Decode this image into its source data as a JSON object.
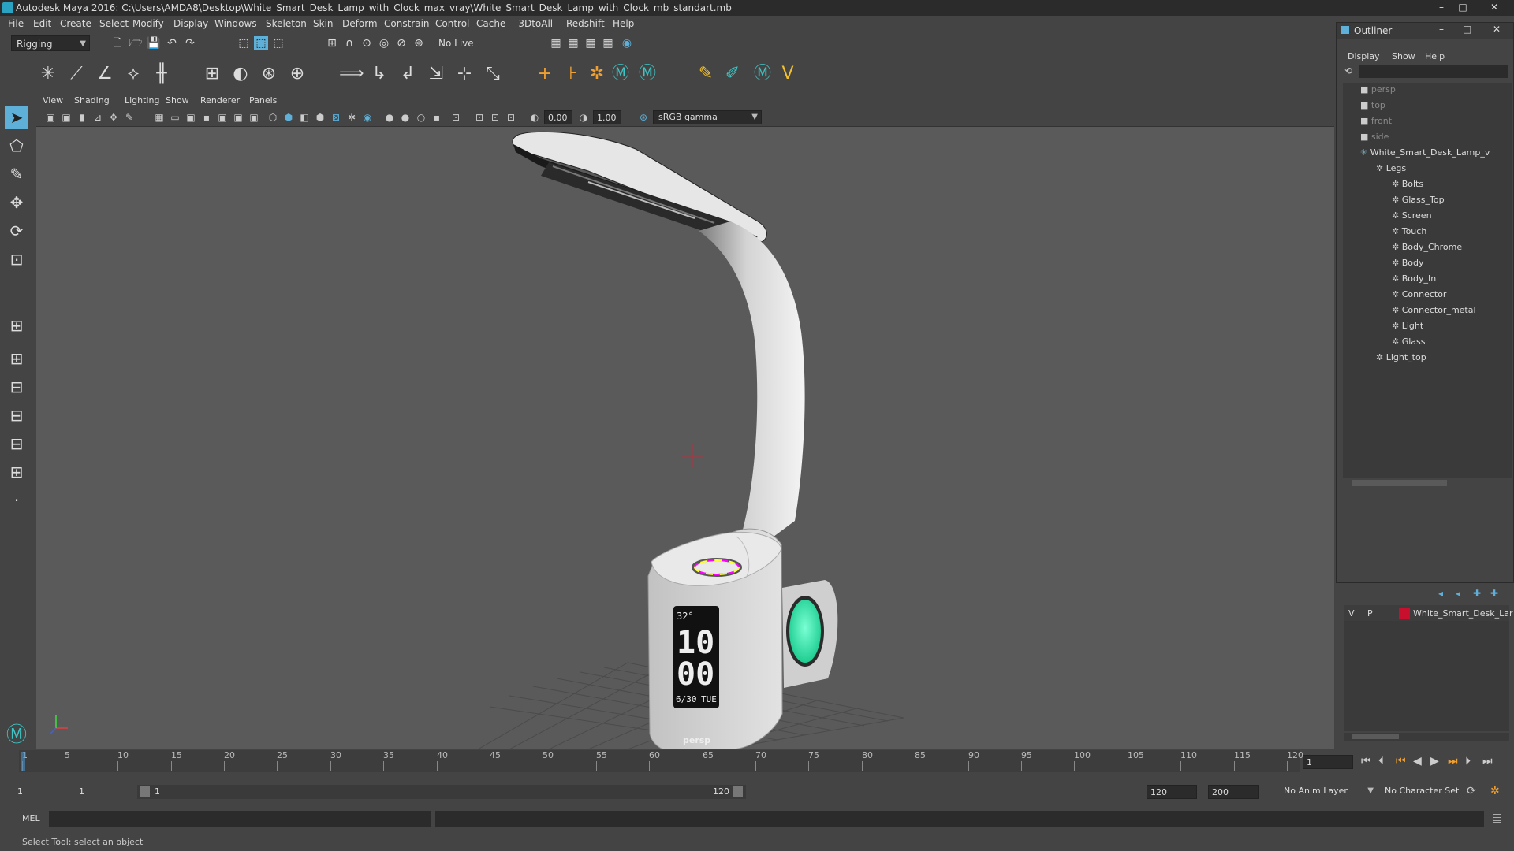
{
  "window": {
    "title": "Autodesk Maya 2016: C:\\Users\\AMDA8\\Desktop\\White_Smart_Desk_Lamp_with_Clock_max_vray\\White_Smart_Desk_Lamp_with_Clock_mb_standart.mb",
    "min": "–",
    "max": "□",
    "close": "✕"
  },
  "menu": [
    "File",
    "Edit",
    "Create",
    "Select",
    "Modify",
    "Display",
    "Windows",
    "Skeleton",
    "Skin",
    "Deform",
    "Constrain",
    "Control",
    "Cache",
    "-3DtoAll -",
    "Redshift",
    "Help"
  ],
  "status": {
    "mode": "Rigging",
    "live_surface": "No Live Surface"
  },
  "panel_menu": [
    "View",
    "Shading",
    "Lighting",
    "Show",
    "Renderer",
    "Panels"
  ],
  "panel_toolbar": {
    "exposure": "0.00",
    "gamma": "1.00",
    "colorspace": "sRGB gamma"
  },
  "viewport": {
    "camera_label": "persp",
    "clock": {
      "temp": "32°",
      "hour": "10",
      "minute": "00",
      "date": "6/30",
      "day": "TUE"
    }
  },
  "outliner": {
    "title": "Outliner",
    "menu": [
      "Display",
      "Show",
      "Help"
    ],
    "items": [
      {
        "label": "persp",
        "dim": true,
        "level": 0,
        "kind": "camera"
      },
      {
        "label": "top",
        "dim": true,
        "level": 0,
        "kind": "camera"
      },
      {
        "label": "front",
        "dim": true,
        "level": 0,
        "kind": "camera"
      },
      {
        "label": "side",
        "dim": true,
        "level": 0,
        "kind": "camera"
      },
      {
        "label": "White_Smart_Desk_Lamp_v",
        "dim": false,
        "level": 0,
        "kind": "group"
      },
      {
        "label": "Legs",
        "dim": false,
        "level": 1,
        "kind": "mesh"
      },
      {
        "label": "Bolts",
        "dim": false,
        "level": 2,
        "kind": "mesh"
      },
      {
        "label": "Glass_Top",
        "dim": false,
        "level": 2,
        "kind": "mesh"
      },
      {
        "label": "Screen",
        "dim": false,
        "level": 2,
        "kind": "mesh"
      },
      {
        "label": "Touch",
        "dim": false,
        "level": 2,
        "kind": "mesh"
      },
      {
        "label": "Body_Chrome",
        "dim": false,
        "level": 2,
        "kind": "mesh"
      },
      {
        "label": "Body",
        "dim": false,
        "level": 2,
        "kind": "mesh"
      },
      {
        "label": "Body_In",
        "dim": false,
        "level": 2,
        "kind": "mesh"
      },
      {
        "label": "Connector",
        "dim": false,
        "level": 2,
        "kind": "mesh"
      },
      {
        "label": "Connector_metal",
        "dim": false,
        "level": 2,
        "kind": "mesh"
      },
      {
        "label": "Light",
        "dim": false,
        "level": 2,
        "kind": "mesh"
      },
      {
        "label": "Glass",
        "dim": false,
        "level": 2,
        "kind": "mesh"
      },
      {
        "label": "Light_top",
        "dim": false,
        "level": 1,
        "kind": "mesh"
      }
    ]
  },
  "layer": {
    "v": "V",
    "p": "P",
    "name": "White_Smart_Desk_Lar",
    "color": "#c8102e"
  },
  "timeline": {
    "ticks": [
      "5",
      "10",
      "15",
      "20",
      "25",
      "30",
      "35",
      "40",
      "45",
      "50",
      "55",
      "60",
      "65",
      "70",
      "75",
      "80",
      "85",
      "90",
      "95",
      "100",
      "105",
      "110",
      "115",
      "120"
    ],
    "first_tick": "1",
    "current_frame": "1"
  },
  "range": {
    "start": "1",
    "playback_start": "1",
    "slider_start": "1",
    "slider_end": "120",
    "playback_end": "120",
    "end": "200",
    "anim_layer": "No Anim Layer",
    "char_set": "No Character Set"
  },
  "cmd": {
    "label": "MEL"
  },
  "help": {
    "text": "Select Tool: select an object"
  },
  "colors": {
    "accent": "#5fb0d8",
    "bg": "#444444",
    "viewport": "#5a5a5a"
  }
}
